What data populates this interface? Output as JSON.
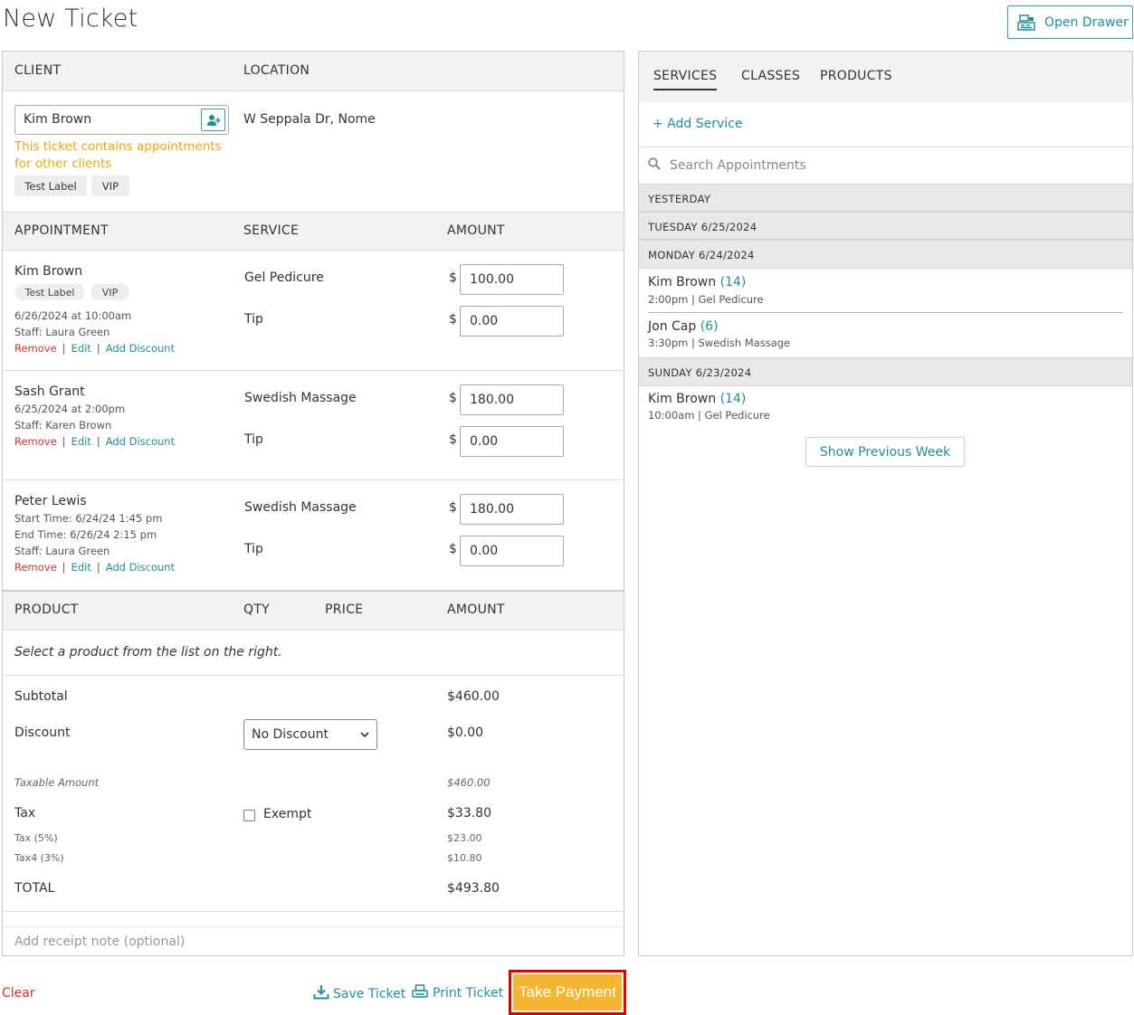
{
  "page": {
    "title": "New Ticket",
    "open_drawer_label": "Open Drawer"
  },
  "client_section": {
    "client_header": "CLIENT",
    "location_header": "LOCATION",
    "client_name": "Kim Brown",
    "warning": "This ticket contains appointments for other clients",
    "tags": [
      "Test Label",
      "VIP"
    ],
    "location": "W Seppala Dr, Nome"
  },
  "appointments_section": {
    "headers": {
      "appointment": "APPOINTMENT",
      "service": "SERVICE",
      "amount": "AMOUNT"
    },
    "currency_symbol": "$",
    "link_remove": "Remove",
    "link_edit": "Edit",
    "link_discount": "Add Discount",
    "link_separator": "|",
    "items": [
      {
        "client": "Kim Brown",
        "tags": [
          "Test Label",
          "VIP"
        ],
        "lines": [
          "6/26/2024 at 10:00am",
          "Staff: Laura Green"
        ],
        "service": "Gel Pedicure",
        "service_amount": "100.00",
        "tip_label": "Tip",
        "tip_amount": "0.00"
      },
      {
        "client": "Sash Grant",
        "tags": [],
        "lines": [
          "6/25/2024 at 2:00pm",
          "Staff: Karen Brown"
        ],
        "service": "Swedish Massage",
        "service_amount": "180.00",
        "tip_label": "Tip",
        "tip_amount": "0.00"
      },
      {
        "client": "Peter Lewis",
        "tags": [],
        "lines": [
          "Start Time: 6/24/24 1:45 pm",
          "End Time: 6/26/24 2:15 pm",
          "Staff: Laura Green"
        ],
        "service": "Swedish Massage",
        "service_amount": "180.00",
        "tip_label": "Tip",
        "tip_amount": "0.00"
      }
    ]
  },
  "products_section": {
    "headers": {
      "product": "PRODUCT",
      "qty": "QTY",
      "price": "PRICE",
      "amount": "AMOUNT"
    },
    "empty_note": "Select a product from the list on the right."
  },
  "totals": {
    "subtotal_label": "Subtotal",
    "subtotal": "$460.00",
    "discount_label": "Discount",
    "discount_select": "No Discount",
    "discount": "$0.00",
    "taxable_label": "Taxable Amount",
    "taxable": "$460.00",
    "tax_label": "Tax",
    "exempt_label": "Exempt",
    "exempt_checked": false,
    "tax": "$33.80",
    "tax1_label": "Tax (5%)",
    "tax1": "$23.00",
    "tax2_label": "Tax4 (3%)",
    "tax2": "$10.80",
    "total_label": "TOTAL",
    "total": "$493.80"
  },
  "receipt_note_placeholder": "Add receipt note (optional)",
  "actions": {
    "clear": "Clear",
    "save_ticket": "Save Ticket",
    "print_ticket": "Print Ticket",
    "take_payment": "Take Payment"
  },
  "right_panel": {
    "tabs": [
      "SERVICES",
      "CLASSES",
      "PRODUCTS"
    ],
    "active_tab": "SERVICES",
    "add_service": "+ Add Service",
    "search_placeholder": "Search Appointments",
    "groups": [
      {
        "label": "YESTERDAY",
        "items": []
      },
      {
        "label": "TUESDAY 6/25/2024",
        "items": []
      },
      {
        "label": "MONDAY 6/24/2024",
        "items": [
          {
            "name": "Kim Brown",
            "count": "(14)",
            "detail": "2:00pm | Gel Pedicure"
          },
          {
            "name": "Jon Cap",
            "count": "(6)",
            "detail": "3:30pm | Swedish Massage"
          }
        ]
      },
      {
        "label": "SUNDAY 6/23/2024",
        "items": [
          {
            "name": "Kim Brown",
            "count": "(14)",
            "detail": "10:00am | Gel Pedicure"
          }
        ]
      }
    ],
    "show_previous_week": "Show Previous Week"
  },
  "colors": {
    "accent": "#1e8fa0",
    "danger": "#d0342c",
    "warning": "#f0a500",
    "pay_button": "#f5b531",
    "highlight_outline": "#e00000"
  }
}
